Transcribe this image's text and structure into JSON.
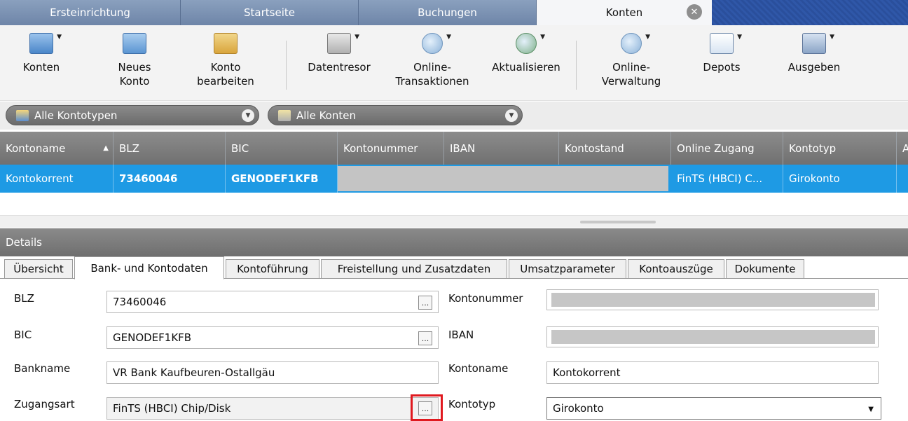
{
  "top_tabs": [
    {
      "label": "Ersteinrichtung"
    },
    {
      "label": "Startseite"
    },
    {
      "label": "Buchungen"
    },
    {
      "label": "Konten"
    }
  ],
  "toolbar": {
    "items": [
      {
        "label": "Konten",
        "icon": "accounts-icon"
      },
      {
        "label": "Neues\nKonto",
        "icon": "new-account-icon"
      },
      {
        "label": "Konto\nbearbeiten",
        "icon": "edit-account-icon"
      },
      {
        "label": "Datentresor",
        "icon": "vault-icon"
      },
      {
        "label": "Online-\nTransaktionen",
        "icon": "online-transactions-icon"
      },
      {
        "label": "Aktualisieren",
        "icon": "refresh-icon"
      },
      {
        "label": "Online-\nVerwaltung",
        "icon": "online-management-icon"
      },
      {
        "label": "Depots",
        "icon": "depots-icon"
      },
      {
        "label": "Ausgeben",
        "icon": "print-icon"
      }
    ]
  },
  "filters": {
    "account_types": "Alle Kontotypen",
    "accounts": "Alle Konten"
  },
  "grid": {
    "columns": [
      "Kontoname",
      "BLZ",
      "BIC",
      "Kontonummer",
      "IBAN",
      "Kontostand",
      "Online Zugang",
      "Kontotyp",
      "A"
    ],
    "rows": [
      {
        "kontoname": "Kontokorrent",
        "blz": "73460046",
        "bic": "GENODEF1KFB",
        "online_zugang": "FinTS (HBCI) C...",
        "kontotyp": "Girokonto"
      }
    ]
  },
  "details": {
    "title": "Details",
    "tabs": [
      "Übersicht",
      "Bank- und Kontodaten",
      "Kontoführung",
      "Freistellung und Zusatzdaten",
      "Umsatzparameter",
      "Kontoauszüge",
      "Dokumente"
    ],
    "active_tab": "Bank- und Kontodaten",
    "fields": {
      "blz": {
        "label": "BLZ",
        "value": "73460046"
      },
      "bic": {
        "label": "BIC",
        "value": "GENODEF1KFB"
      },
      "bankname": {
        "label": "Bankname",
        "value": "VR Bank Kaufbeuren-Ostallgäu"
      },
      "zugangsart": {
        "label": "Zugangsart",
        "value": "FinTS (HBCI) Chip/Disk"
      },
      "kontonummer": {
        "label": "Kontonummer"
      },
      "iban": {
        "label": "IBAN"
      },
      "kontoname": {
        "label": "Kontoname",
        "value": "Kontokorrent"
      },
      "kontotyp": {
        "label": "Kontotyp",
        "value": "Girokonto"
      }
    },
    "ellipsis_label": "..."
  },
  "colors": {
    "selection": "#1e9ae4",
    "highlight": "#e0191f",
    "tab_bar": "#6c84a8"
  }
}
